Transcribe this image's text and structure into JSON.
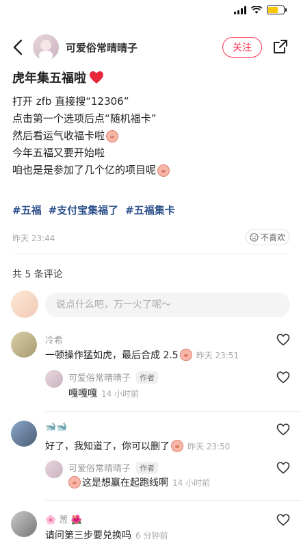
{
  "header": {
    "author_name": "可爱俗常晴晴子",
    "follow_label": "关注"
  },
  "post": {
    "title": "虎年集五福啦",
    "lines": [
      "打开 zfb 直接搜“12306”",
      "点击第一个选项后点“随机福卡”",
      "然后看运气收福卡啦",
      "今年五福又要开始啦",
      "咱也是是参加了几个亿的项目呢"
    ],
    "tags": [
      "#五福",
      "#支付宝集福了",
      "#五福集卡"
    ],
    "date": "昨天 23:44",
    "dislike_label": "不喜欢"
  },
  "comments_section": {
    "count_label": "共 5 条评论",
    "input_placeholder": "说点什么吧，万一火了呢～",
    "comments": [
      {
        "name": "冷希",
        "text": "一顿操作猛如虎，最后合成 2.5",
        "time": "昨天 23:51",
        "reply": {
          "name": "可爱俗常晴晴子",
          "badge": "作者",
          "text": "嘎嘎嘎",
          "time": "14 小时前"
        }
      },
      {
        "name": "🐋🐋",
        "text": "好了，我知道了，你可以删了",
        "time": "昨天 23:50",
        "reply": {
          "name": "可爱俗常晴晴子",
          "badge": "作者",
          "text": "这是想赢在起跑线啊",
          "time": "14 小时前"
        }
      },
      {
        "name": "🌸 葱 🌺",
        "text": "请问第三步要兑换吗",
        "time": "6 分钟前"
      }
    ]
  },
  "colors": {
    "accent": "#ff2e4d",
    "tag": "#2c4f8b"
  }
}
